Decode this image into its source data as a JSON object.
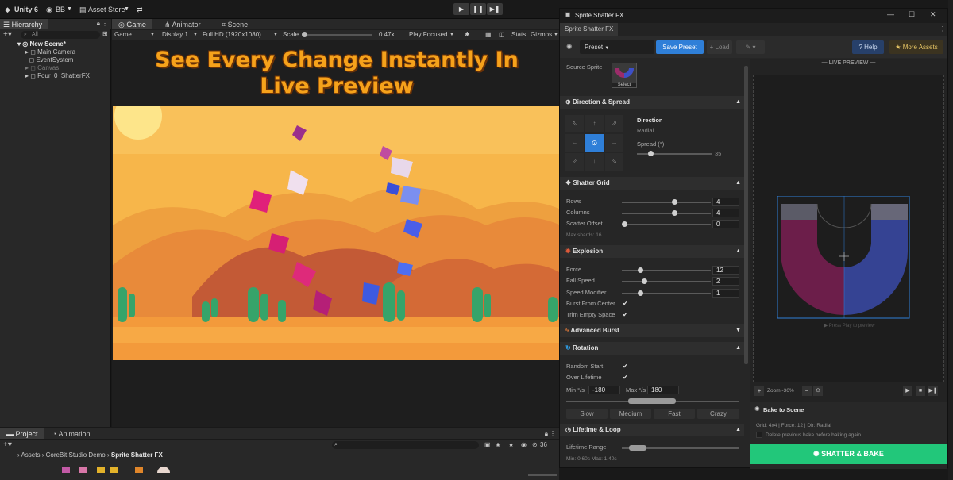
{
  "toolbar": {
    "app_name": "Unity 6",
    "account": "BB",
    "asset_store": "Asset Store"
  },
  "hierarchy": {
    "tab": "Hierarchy",
    "search_placeholder": "All",
    "items": [
      {
        "label": "New Scene*"
      },
      {
        "label": "Main Camera"
      },
      {
        "label": "EventSystem"
      },
      {
        "label": "Canvas"
      },
      {
        "label": "Four_0_ShatterFX"
      }
    ]
  },
  "game": {
    "tabs": [
      "Game",
      "Animator",
      "Scene"
    ],
    "mode": "Game",
    "display": "Display 1",
    "resolution": "Full HD (1920x1080)",
    "scale_label": "Scale",
    "scale_value": "0.47x",
    "play_focused": "Play Focused",
    "stats": "Stats",
    "gizmos": "Gizmos",
    "headline_line1": "See Every Change Instantly In",
    "headline_line2": "Live Preview"
  },
  "project": {
    "tabs": [
      "Project",
      "Animation"
    ],
    "breadcrumb": [
      "Assets",
      "CoreBit Studio Demo",
      "Sprite Shatter FX"
    ],
    "count": "36"
  },
  "fx": {
    "window_title": "Sprite Shatter FX",
    "tab": "Sprite Shatter FX",
    "preset": "Preset",
    "save_preset": "Save Preset",
    "load": "+ Load",
    "help": "? Help",
    "more_assets": "More Assets",
    "source_sprite_label": "Source Sprite",
    "select_label": "Select",
    "direction": {
      "title": "Direction & Spread",
      "heading": "Direction",
      "mode": "Radial",
      "spread_label": "Spread (°)",
      "spread_value": "35"
    },
    "grid": {
      "title": "Shatter Grid",
      "rows_label": "Rows",
      "rows": "4",
      "columns_label": "Columns",
      "columns": "4",
      "scatter_label": "Scatter Offset",
      "scatter": "0",
      "max_shards": "Max shards: 16"
    },
    "explosion": {
      "title": "Explosion",
      "force_label": "Force",
      "force": "12",
      "fall_label": "Fall Speed",
      "fall": "2",
      "speed_label": "Speed Modifier",
      "speed": "1",
      "burst_label": "Burst From Center",
      "trim_label": "Trim Empty Space"
    },
    "advanced_burst": "Advanced Burst",
    "rotation": {
      "title": "Rotation",
      "random_label": "Random Start",
      "over_label": "Over Lifetime",
      "min_label": "Min °/s",
      "min": "-180",
      "max_label": "Max °/s",
      "max": "180",
      "presets": [
        "Slow",
        "Medium",
        "Fast",
        "Crazy"
      ]
    },
    "lifetime": {
      "title": "Lifetime & Loop",
      "range_label": "Lifetime Range",
      "range_text": "Min: 0.60s    Max: 1.40s"
    },
    "preview": {
      "title": "— LIVE PREVIEW —",
      "hint": "▶ Press Play to preview",
      "zoom": "Zoom -36%"
    },
    "bake": {
      "title": "Bake to Scene",
      "info": "Grid: 4x4  |  Force: 12  |  Dir: Radial",
      "delete_label": "Delete previous bake before baking again",
      "button": "SHATTER & BAKE"
    }
  },
  "colors": {
    "accent_blue": "#2f7fd8",
    "bake_green": "#22c77a",
    "headline_orange": "#f6a21b"
  }
}
